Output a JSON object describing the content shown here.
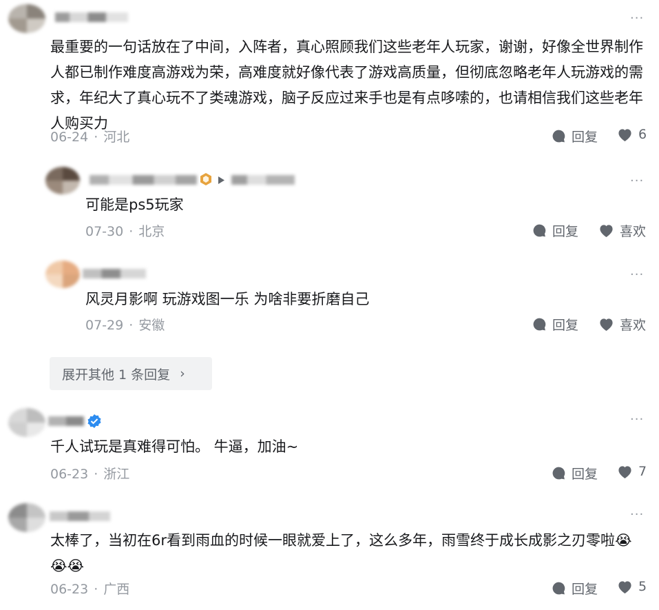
{
  "comments": [
    {
      "text": "最重要的一句话放在了中间，入阵者，真心照顾我们这些老年人玩家，谢谢，好像全世界制作人都已制作难度高游戏为荣，高难度就好像代表了游戏高质量，但彻底忽略老年人玩游戏的需求，年纪大了真心玩不了类魂游戏，脑子反应过来手也是有点哆嗦的，也请相信我们这些老年人购买力",
      "date": "06-24",
      "location": "河北",
      "reply_label": "回复",
      "likes": "6",
      "replies": [
        {
          "text": "可能是ps5玩家",
          "date": "07-30",
          "location": "北京",
          "reply_label": "回复",
          "like_label": "喜欢"
        },
        {
          "text": "风灵月影啊 玩游戏图一乐 为啥非要折磨自己",
          "date": "07-29",
          "location": "安徽",
          "reply_label": "回复",
          "like_label": "喜欢"
        }
      ],
      "expand_label": "展开其他 1 条回复",
      "expand_chevron": "›"
    },
    {
      "text": "千人试玩是真难得可怕。 牛逼，加油~",
      "date": "06-23",
      "location": "浙江",
      "reply_label": "回复",
      "likes": "7"
    },
    {
      "text": "太棒了，当初在6r看到雨血的时候一眼就爱上了，这么多年，雨雪终于成长成影之刃零啦",
      "emoji": "😭😭😭",
      "date": "06-23",
      "location": "广西",
      "reply_label": "回复",
      "likes": "5"
    }
  ],
  "separator": "·",
  "more_label": "···",
  "icons": {
    "reply": "reply-bubble-icon",
    "like": "heart-icon",
    "more": "more-dots-icon",
    "verified": "verified-badge-icon",
    "level": "level-badge-icon"
  },
  "colors": {
    "text": "#18191c",
    "meta": "#9499a0",
    "action": "#61666d",
    "icon": "#61666d",
    "verified": "#2d8cf0",
    "badge": "#e7a33e"
  }
}
